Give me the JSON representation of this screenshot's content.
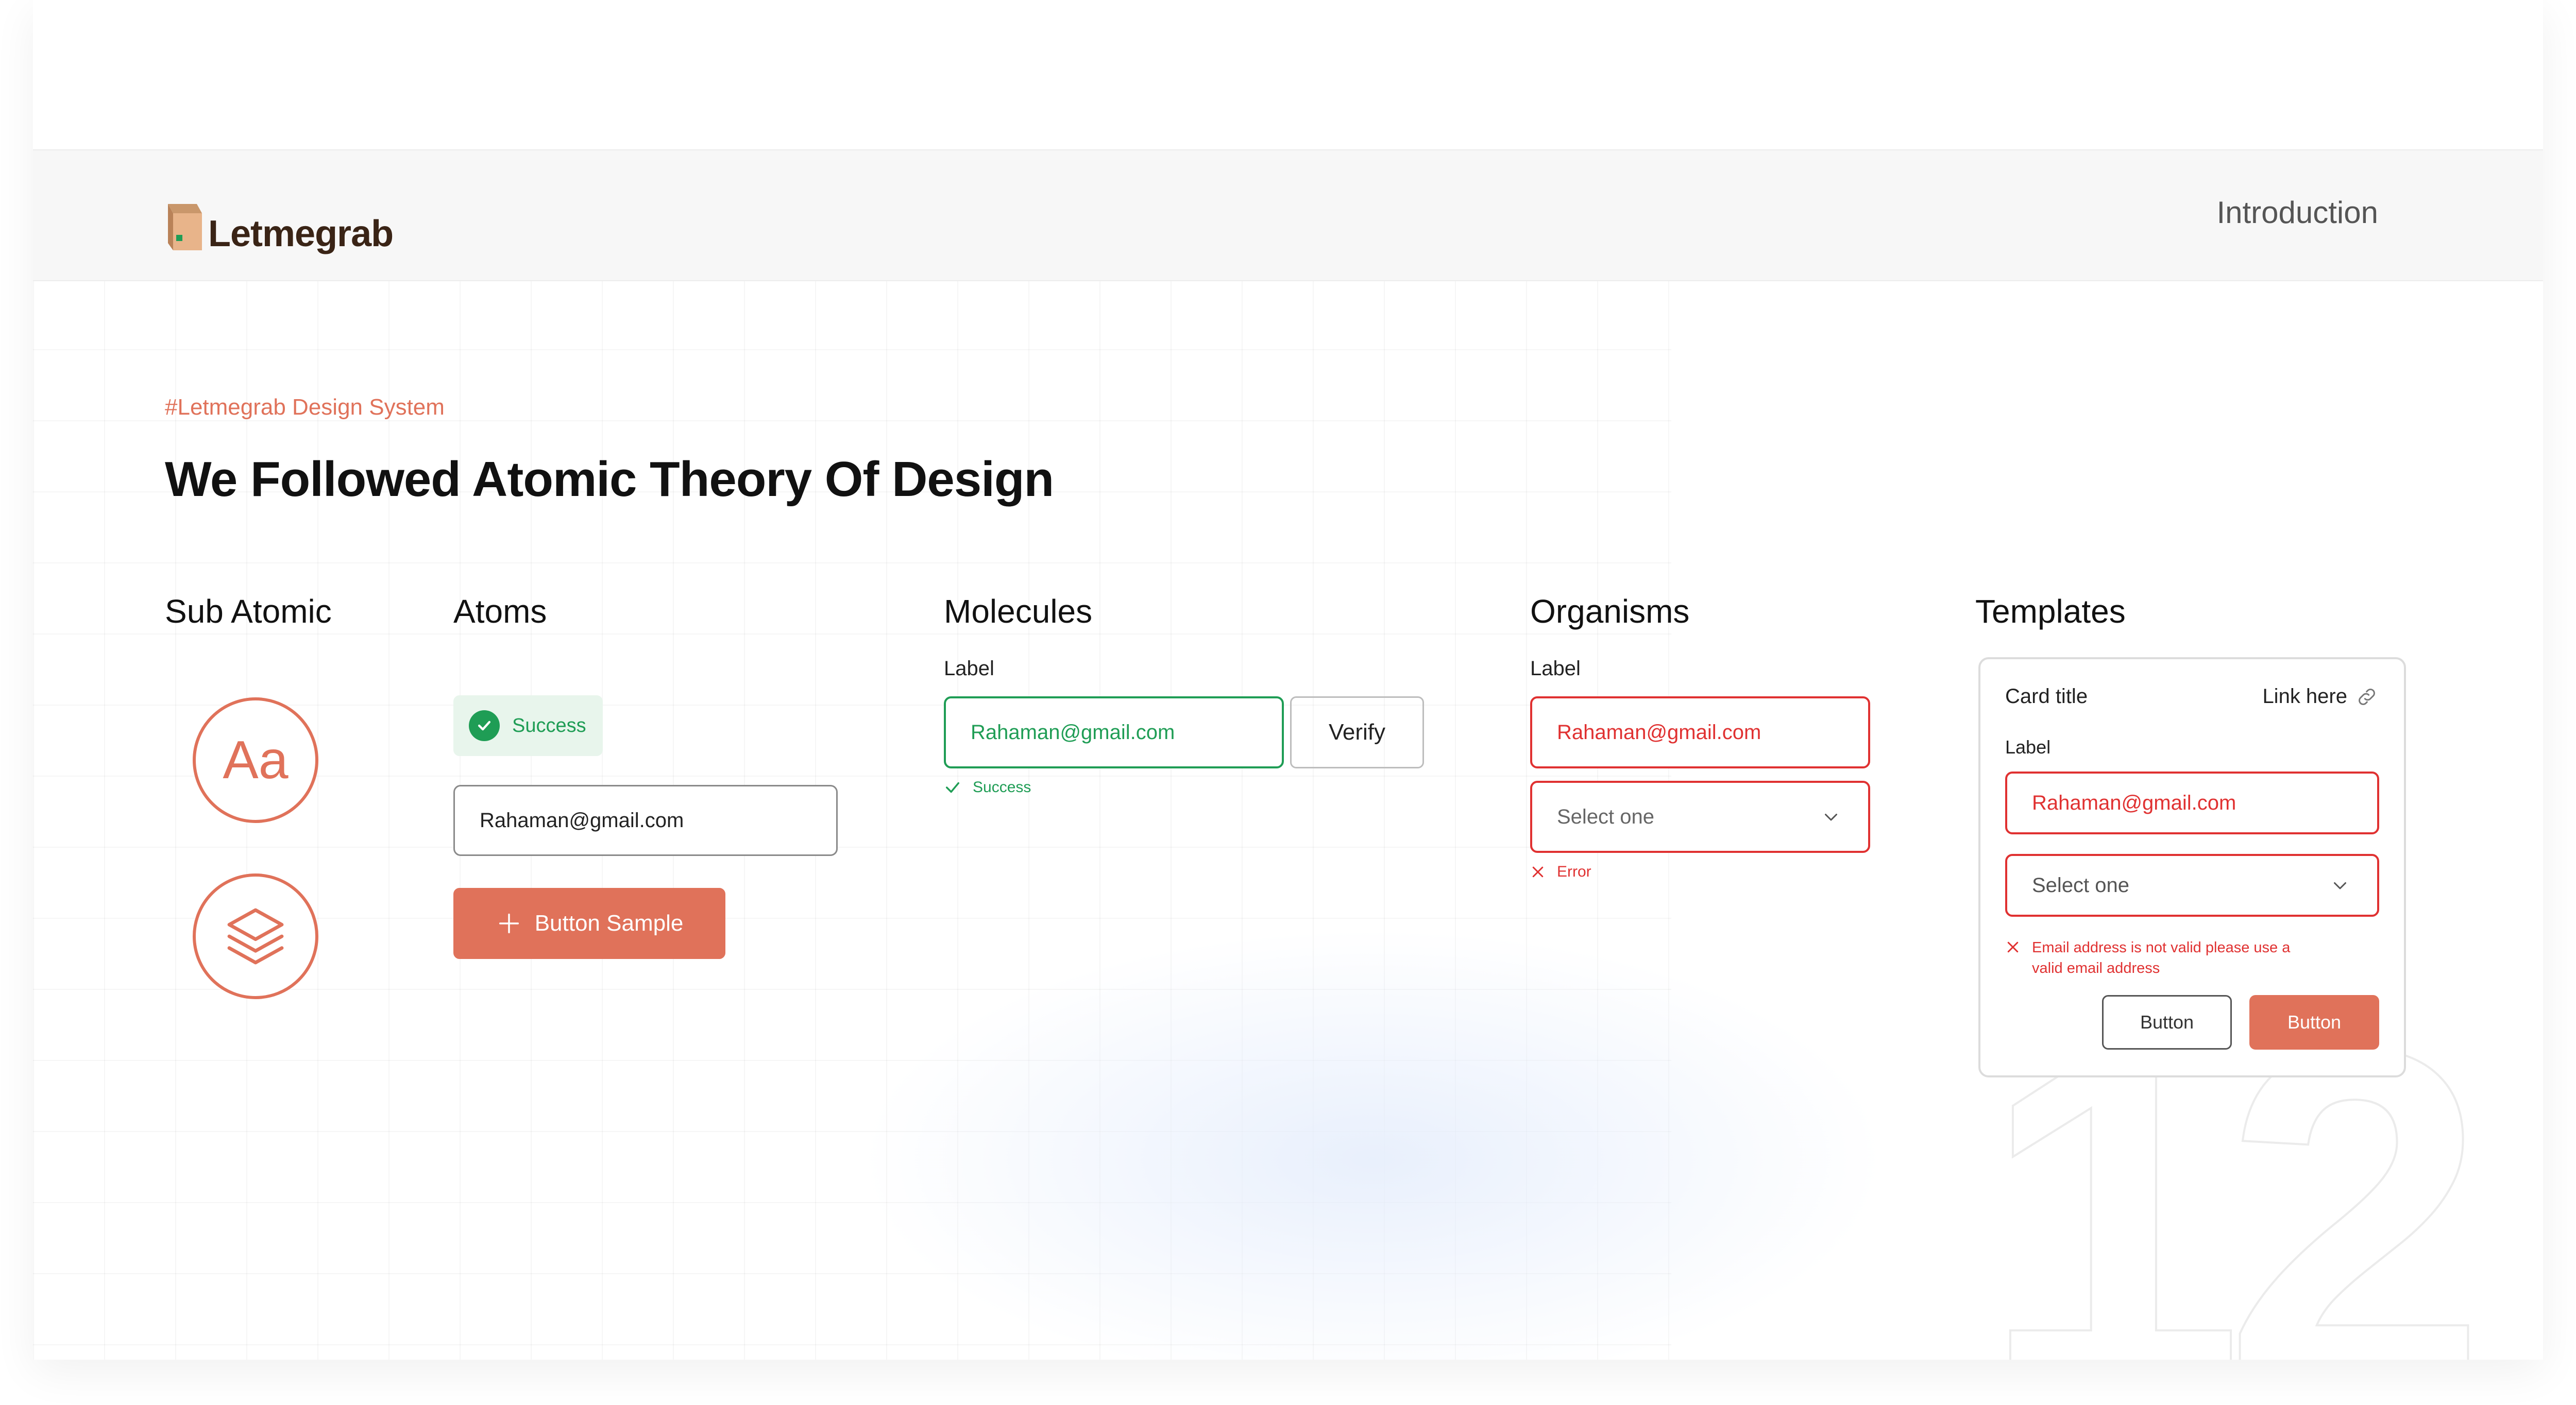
{
  "header": {
    "brand": "Letmegrab",
    "nav_link": "Introduction"
  },
  "hero": {
    "eyebrow": "#Letmegrab Design System",
    "title": "We Followed Atomic Theory Of Design"
  },
  "columns": {
    "sub_atomic": "Sub Atomic",
    "atoms": "Atoms",
    "molecules": "Molecules",
    "organisms": "Organisms",
    "templates": "Templates"
  },
  "sub_atomic": {
    "type_sample": "Aa",
    "icon": "layers-icon"
  },
  "atoms": {
    "badge_label": "Success",
    "input_value": "Rahaman@gmail.com",
    "button_label": "Button Sample"
  },
  "molecules": {
    "label": "Label",
    "input_value": "Rahaman@gmail.com",
    "verify_label": "Verify",
    "hint": "Success"
  },
  "organisms": {
    "label": "Label",
    "input_value": "Rahaman@gmail.com",
    "select_value": "Select one",
    "error": "Error"
  },
  "templates": {
    "card_title": "Card title",
    "link_label": "Link here",
    "label": "Label",
    "input_value": "Rahaman@gmail.com",
    "select_value": "Select one",
    "error_line1": "Email address is not valid please use a",
    "error_line2": "valid email address",
    "secondary_button": "Button",
    "primary_button": "Button"
  },
  "decor_number": "12",
  "colors": {
    "accent": "#e0725a",
    "success": "#1f9d55",
    "error": "#e03131",
    "text": "#111111"
  }
}
